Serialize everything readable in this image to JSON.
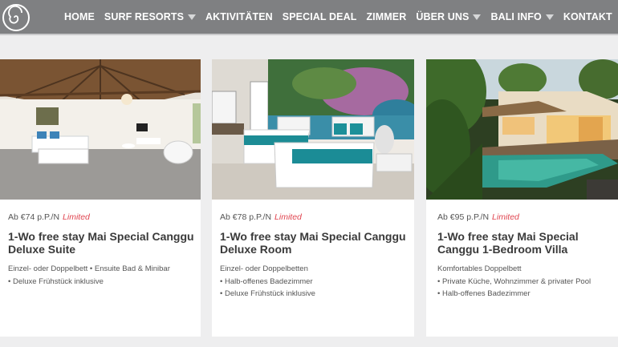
{
  "nav": {
    "logo_icon": "spiral-logo-icon",
    "items": [
      {
        "label": "HOME",
        "has_caret": false
      },
      {
        "label": "SURF RESORTS",
        "has_caret": true
      },
      {
        "label": "AKTIVITÄTEN",
        "has_caret": false
      },
      {
        "label": "SPECIAL DEAL",
        "has_caret": false
      },
      {
        "label": "ZIMMER",
        "has_caret": false
      },
      {
        "label": "ÜBER UNS",
        "has_caret": true
      },
      {
        "label": "BALI INFO",
        "has_caret": true
      },
      {
        "label": "KONTAKT",
        "has_caret": false
      }
    ]
  },
  "cards": [
    {
      "price": "Ab €74 p.P./N",
      "badge": "Limited",
      "title": "1-Wo free stay Mai Special Canggu Deluxe Suite",
      "lines": [
        "Einzel- oder Doppelbett • Ensuite Bad & Minibar",
        "• Deluxe Frühstück inklusive"
      ]
    },
    {
      "price": "Ab €78 p.P./N",
      "badge": "Limited",
      "title": "1-Wo free stay Mai Special Canggu Deluxe Room",
      "lines": [
        "Einzel- oder Doppelbetten",
        "• Halb-offenes Badezimmer",
        "• Deluxe Frühstück inklusive"
      ]
    },
    {
      "price": "Ab €95 p.P./N",
      "badge": "Limited",
      "title": "1-Wo free stay Mai Special Canggu 1-Bedroom Villa",
      "lines": [
        "Komfortables Doppelbett",
        "• Private Küche, Wohnzimmer & privater Pool",
        "• Halb-offenes Badezimmer"
      ]
    }
  ],
  "colors": {
    "nav_bg": "#7f8082",
    "page_bg": "#eeeeef",
    "limited": "#e0444f",
    "title": "#3a3a3a"
  }
}
